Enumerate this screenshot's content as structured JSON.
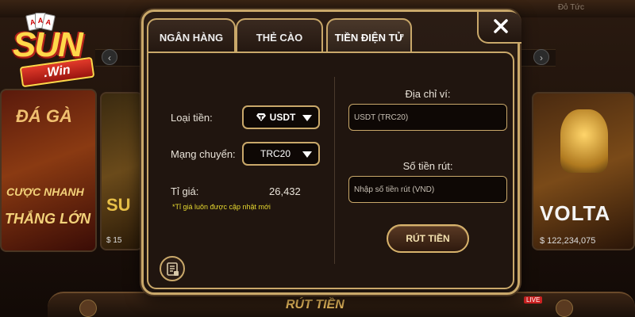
{
  "brand": {
    "logo_word": "SUN",
    "logo_ribbon": ".Win"
  },
  "background": {
    "topbar_text": "Đỏ Tức",
    "left_card": {
      "line1": "ĐÁ GÀ",
      "line2": "CƯỢC NHANH",
      "line3": "THẮNG LỚN"
    },
    "mid_card": {
      "title": "SU",
      "amount": "$ 15"
    },
    "right_card": {
      "title": "VOLTA",
      "amount": "$ 122,234,075"
    },
    "bottom_nav_label": "RÚT TIỀN",
    "live_badge": "LIVE"
  },
  "modal": {
    "tabs": [
      {
        "label": "NGÂN HÀNG",
        "active": false
      },
      {
        "label": "THẺ CÀO",
        "active": false
      },
      {
        "label": "TIỀN ĐIỆN TỬ",
        "active": true
      }
    ],
    "close_label": "close",
    "left": {
      "currency_label": "Loại tiền:",
      "currency_value": "USDT",
      "network_label": "Mạng chuyển:",
      "network_value": "TRC20",
      "rate_label": "Tỉ giá:",
      "rate_value": "26,432",
      "rate_note": "*Tỉ giá luôn được cập nhật mới"
    },
    "right": {
      "wallet_label": "Địa chỉ ví:",
      "wallet_placeholder": "USDT (TRC20)",
      "amount_label": "Số tiền rút:",
      "amount_placeholder": "Nhập số tiền rút (VND)",
      "submit_label": "RÚT TIỀN"
    }
  },
  "colors": {
    "border_gold": "#c9a86a",
    "panel_bg": "#20150f",
    "note_yellow": "#e6d830"
  }
}
